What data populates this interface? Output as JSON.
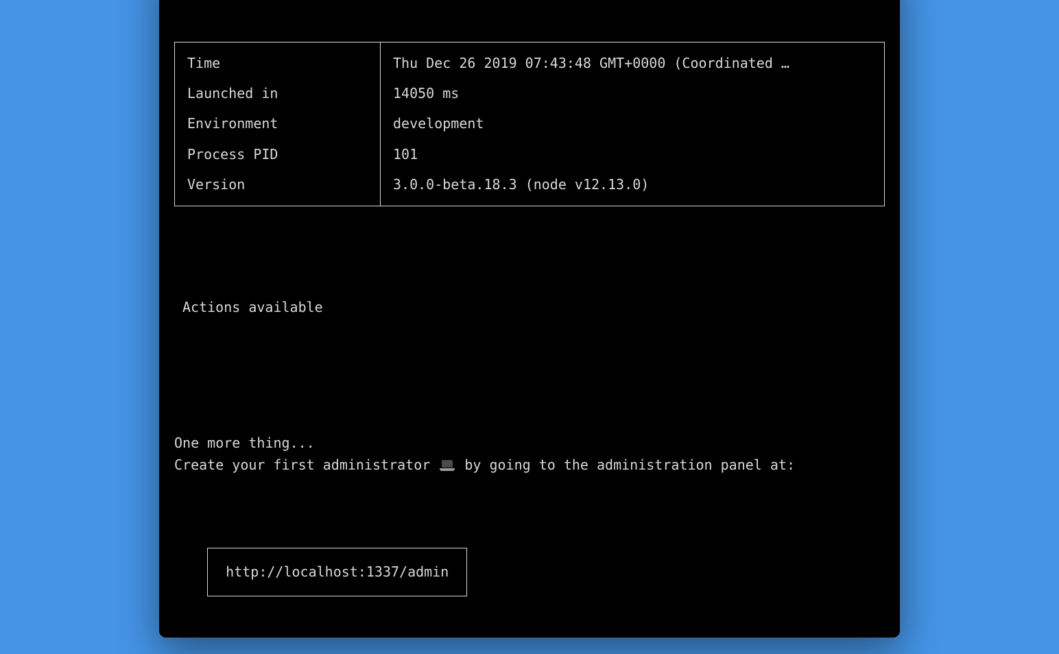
{
  "info_rows": [
    {
      "key": "Time",
      "value": "Thu Dec 26 2019 07:43:48 GMT+0000 (Coordinated …"
    },
    {
      "key": "Launched in",
      "value": "14050 ms"
    },
    {
      "key": "Environment",
      "value": "development"
    },
    {
      "key": "Process PID",
      "value": "101"
    },
    {
      "key": "Version",
      "value": "3.0.0-beta.18.3 (node v12.13.0)"
    }
  ],
  "section_title": "Actions available",
  "body_line1": "One more thing...",
  "body_line2_pre": "Create your first administrator ",
  "body_line2_post": " by going to the administration panel at:",
  "admin_url": "http://localhost:1337/admin"
}
